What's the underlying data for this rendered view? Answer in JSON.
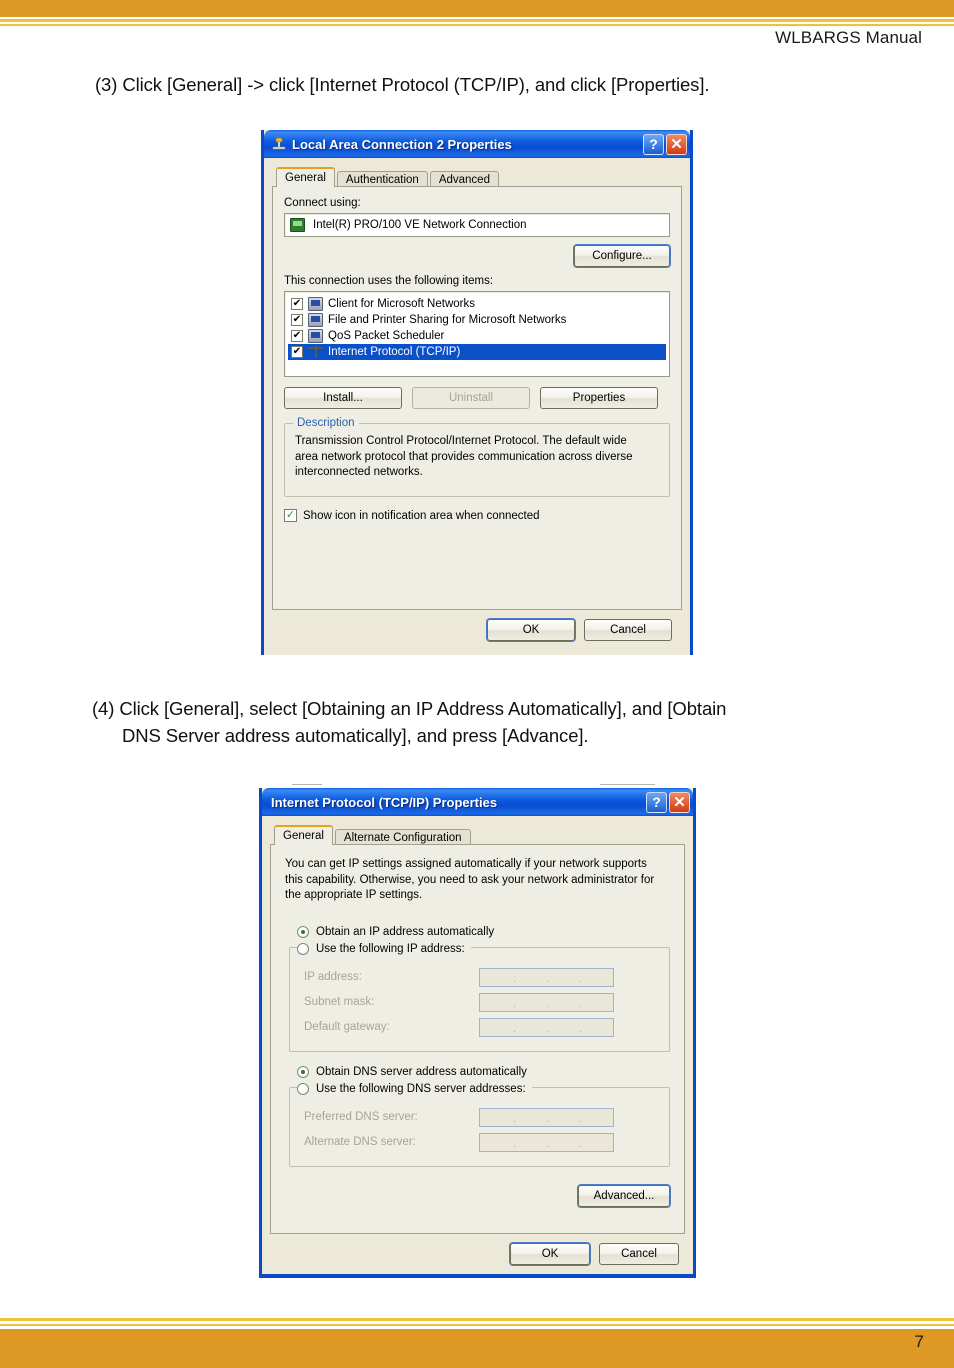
{
  "page": {
    "header_title": "WLBARGS Manual",
    "page_number": "7",
    "accent_bar": "#dd9923",
    "accent_line": "#e8c53c"
  },
  "steps": {
    "step3": "(3) Click [General] -> click [Internet Protocol (TCP/IP), and click [Properties].",
    "step4_line1": "(4) Click [General], select [Obtaining an IP Address Automatically], and [Obtain",
    "step4_line2": "DNS Server address automatically], and press [Advance]."
  },
  "dialog1": {
    "title": "Local Area Connection 2 Properties",
    "title_icon": "network-connection-icon",
    "help_button": "?",
    "close_button": "✕",
    "tabs": [
      {
        "label": "General",
        "active": true
      },
      {
        "label": "Authentication",
        "active": false
      },
      {
        "label": "Advanced",
        "active": false
      }
    ],
    "connect_using_label": "Connect using:",
    "adapter": "Intel(R) PRO/100 VE Network Connection",
    "configure_button": "Configure...",
    "items_label": "This connection uses the following items:",
    "components": [
      {
        "label": "Client for Microsoft Networks",
        "checked": true,
        "selected": false,
        "icon": "computer-icon"
      },
      {
        "label": "File and Printer Sharing for Microsoft Networks",
        "checked": true,
        "selected": false,
        "icon": "computer-icon"
      },
      {
        "label": "QoS Packet Scheduler",
        "checked": true,
        "selected": false,
        "icon": "computer-icon"
      },
      {
        "label": "Internet Protocol (TCP/IP)",
        "checked": true,
        "selected": true,
        "icon": "protocol-icon"
      }
    ],
    "install_button": "Install...",
    "uninstall_button": "Uninstall",
    "uninstall_disabled": true,
    "properties_button": "Properties",
    "description_legend": "Description",
    "description_text": "Transmission Control Protocol/Internet Protocol. The default wide area network protocol that provides communication across diverse interconnected networks.",
    "notify_checkbox_label": "Show icon in notification area when connected",
    "notify_checkbox_checked": true,
    "ok_button": "OK",
    "cancel_button": "Cancel"
  },
  "dialog2": {
    "title": "Internet Protocol (TCP/IP) Properties",
    "help_button": "?",
    "close_button": "✕",
    "tabs": [
      {
        "label": "General",
        "active": true
      },
      {
        "label": "Alternate Configuration",
        "active": false
      }
    ],
    "intro_text": "You can get IP settings assigned automatically if your network supports this capability. Otherwise, you need to ask your network administrator for the appropriate IP settings.",
    "ip_auto_label": "Obtain an IP address automatically",
    "ip_auto_selected": true,
    "ip_manual_label": "Use the following IP address:",
    "ip_manual_selected": false,
    "ip_fields": [
      {
        "label": "IP address:",
        "value": ""
      },
      {
        "label": "Subnet mask:",
        "value": ""
      },
      {
        "label": "Default gateway:",
        "value": ""
      }
    ],
    "dns_auto_label": "Obtain DNS server address automatically",
    "dns_auto_selected": true,
    "dns_manual_label": "Use the following DNS server addresses:",
    "dns_manual_selected": false,
    "dns_fields": [
      {
        "label": "Preferred DNS server:",
        "value": ""
      },
      {
        "label": "Alternate DNS server:",
        "value": ""
      }
    ],
    "advanced_button": "Advanced...",
    "ok_button": "OK",
    "cancel_button": "Cancel"
  }
}
